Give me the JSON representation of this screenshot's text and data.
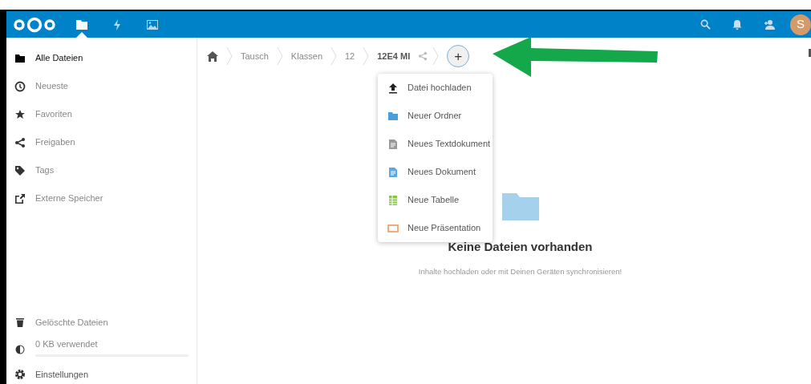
{
  "header": {
    "apps": [
      {
        "kind": "files",
        "selected": true
      },
      {
        "kind": "activity",
        "selected": false
      },
      {
        "kind": "gallery",
        "selected": false
      }
    ],
    "avatar": "S"
  },
  "sidebar": {
    "items": [
      {
        "kind": "folder",
        "label": "Alle Dateien",
        "selected": true
      },
      {
        "kind": "clock",
        "label": "Neueste",
        "selected": false
      },
      {
        "kind": "star",
        "label": "Favoriten",
        "selected": false
      },
      {
        "kind": "share",
        "label": "Freigaben",
        "selected": false
      },
      {
        "kind": "tag",
        "label": "Tags",
        "selected": false
      },
      {
        "kind": "external",
        "label": "Externe Speicher",
        "selected": false
      }
    ],
    "trash": "Gelöschte Dateien",
    "quota": {
      "label": "0 KB verwendet"
    },
    "settings": "Einstellungen"
  },
  "breadcrumbs": [
    "Tausch",
    "Klassen",
    "12",
    "12E4 MI"
  ],
  "new_menu": {
    "button": "+",
    "items": [
      {
        "kind": "upload",
        "label": "Datei hochladen"
      },
      {
        "kind": "folder",
        "label": "Neuer Ordner"
      },
      {
        "kind": "text",
        "label": "Neues Textdokument"
      },
      {
        "kind": "document",
        "label": "Neues Dokument"
      },
      {
        "kind": "spreadsheet",
        "label": "Neue Tabelle"
      },
      {
        "kind": "presentation",
        "label": "Neue Präsentation"
      }
    ]
  },
  "empty": {
    "title": "Keine Dateien vorhanden",
    "hint": "Inhalte hochladen oder mit Deinen Geräten synchronisieren!"
  }
}
